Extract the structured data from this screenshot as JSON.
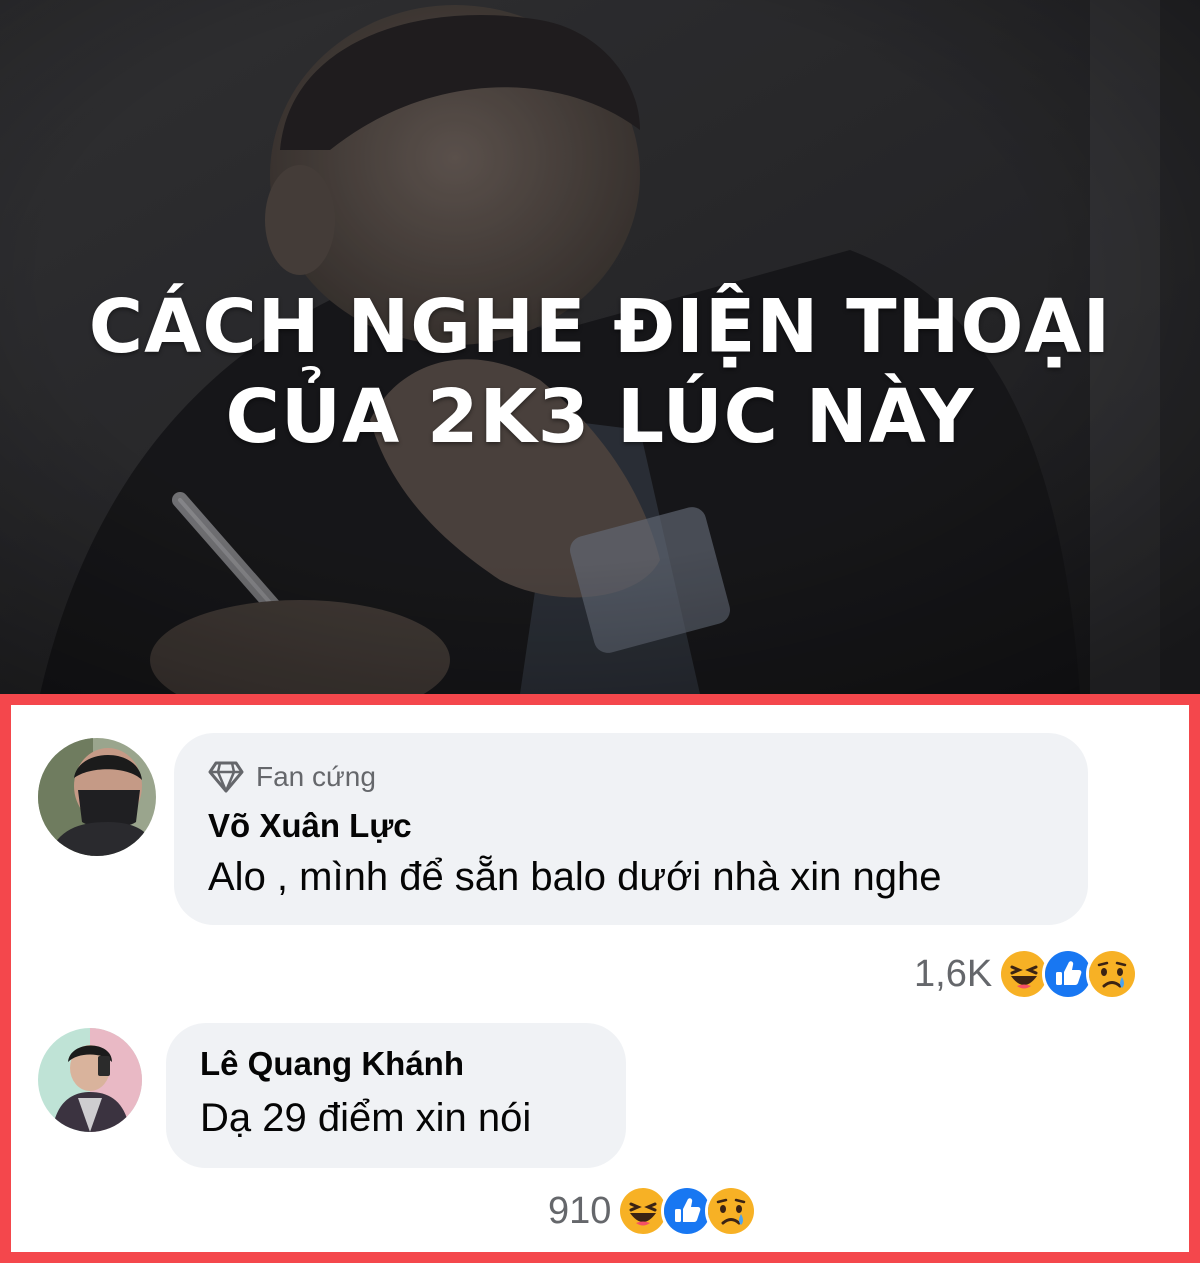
{
  "hero": {
    "title_line1": "CÁCH NGHE ĐIỆN THOẠI",
    "title_line2": "CỦA 2K3 LÚC NÀY"
  },
  "comments": [
    {
      "badge": "Fan cứng",
      "badge_icon": "diamond-icon",
      "author": "Võ Xuân Lực",
      "text": "Alo , mình để sẵn balo dưới nhà xin nghe",
      "reaction_count": "1,6K",
      "reactions": [
        "haha-icon",
        "like-icon",
        "sad-icon"
      ]
    },
    {
      "author": "Lê Quang Khánh",
      "text": "Dạ 29 điểm xin nói",
      "reaction_count": "910",
      "reactions": [
        "haha-icon",
        "like-icon",
        "sad-icon"
      ]
    }
  ],
  "colors": {
    "frame_border": "#f4474c",
    "bubble_bg": "#f0f2f5",
    "hero_overlay": "#2b2b2d",
    "like_blue": "#1877f2",
    "emoji_yellow": "#f7b125"
  }
}
